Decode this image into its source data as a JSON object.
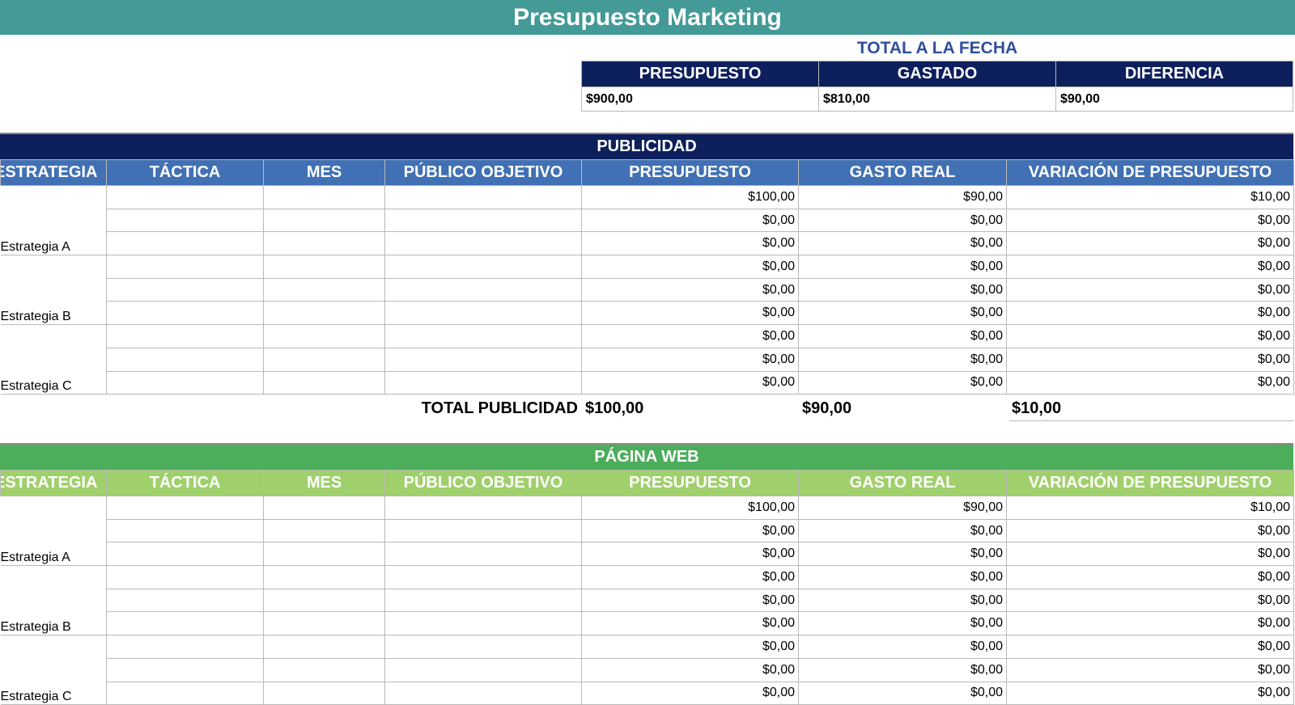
{
  "title": "Presupuesto Marketing",
  "totals": {
    "caption": "TOTAL A LA FECHA",
    "headers": [
      "PRESUPUESTO",
      "GASTADO",
      "DIFERENCIA"
    ],
    "values": [
      "$900,00",
      "$810,00",
      "$90,00"
    ]
  },
  "columns": [
    "ESTRATEGIA",
    "TÁCTICA",
    "MES",
    "PÚBLICO OBJETIVO",
    "PRESUPUESTO",
    "GASTO REAL",
    "VARIACIÓN DE PRESUPUESTO"
  ],
  "sections": [
    {
      "name": "PUBLICIDAD",
      "rows": [
        {
          "strategy": "",
          "tactic": "",
          "month": "",
          "audience": "",
          "budget": "$100,00",
          "spent": "$90,00",
          "variance": "$10,00"
        },
        {
          "strategy": "",
          "tactic": "",
          "month": "",
          "audience": "",
          "budget": "$0,00",
          "spent": "$0,00",
          "variance": "$0,00"
        },
        {
          "strategy": "Estrategia A",
          "tactic": "",
          "month": "",
          "audience": "",
          "budget": "$0,00",
          "spent": "$0,00",
          "variance": "$0,00"
        },
        {
          "strategy": "",
          "tactic": "",
          "month": "",
          "audience": "",
          "budget": "$0,00",
          "spent": "$0,00",
          "variance": "$0,00"
        },
        {
          "strategy": "",
          "tactic": "",
          "month": "",
          "audience": "",
          "budget": "$0,00",
          "spent": "$0,00",
          "variance": "$0,00"
        },
        {
          "strategy": "Estrategia B",
          "tactic": "",
          "month": "",
          "audience": "",
          "budget": "$0,00",
          "spent": "$0,00",
          "variance": "$0,00"
        },
        {
          "strategy": "",
          "tactic": "",
          "month": "",
          "audience": "",
          "budget": "$0,00",
          "spent": "$0,00",
          "variance": "$0,00"
        },
        {
          "strategy": "",
          "tactic": "",
          "month": "",
          "audience": "",
          "budget": "$0,00",
          "spent": "$0,00",
          "variance": "$0,00"
        },
        {
          "strategy": "Estrategia C",
          "tactic": "",
          "month": "",
          "audience": "",
          "budget": "$0,00",
          "spent": "$0,00",
          "variance": "$0,00"
        }
      ],
      "total": {
        "label": "TOTAL PUBLICIDAD",
        "budget": "$100,00",
        "spent": "$90,00",
        "variance": "$10,00"
      }
    },
    {
      "name": "PÁGINA WEB",
      "rows": [
        {
          "strategy": "",
          "tactic": "",
          "month": "",
          "audience": "",
          "budget": "$100,00",
          "spent": "$90,00",
          "variance": "$10,00"
        },
        {
          "strategy": "",
          "tactic": "",
          "month": "",
          "audience": "",
          "budget": "$0,00",
          "spent": "$0,00",
          "variance": "$0,00"
        },
        {
          "strategy": "Estrategia A",
          "tactic": "",
          "month": "",
          "audience": "",
          "budget": "$0,00",
          "spent": "$0,00",
          "variance": "$0,00"
        },
        {
          "strategy": "",
          "tactic": "",
          "month": "",
          "audience": "",
          "budget": "$0,00",
          "spent": "$0,00",
          "variance": "$0,00"
        },
        {
          "strategy": "",
          "tactic": "",
          "month": "",
          "audience": "",
          "budget": "$0,00",
          "spent": "$0,00",
          "variance": "$0,00"
        },
        {
          "strategy": "Estrategia B",
          "tactic": "",
          "month": "",
          "audience": "",
          "budget": "$0,00",
          "spent": "$0,00",
          "variance": "$0,00"
        },
        {
          "strategy": "",
          "tactic": "",
          "month": "",
          "audience": "",
          "budget": "$0,00",
          "spent": "$0,00",
          "variance": "$0,00"
        },
        {
          "strategy": "",
          "tactic": "",
          "month": "",
          "audience": "",
          "budget": "$0,00",
          "spent": "$0,00",
          "variance": "$0,00"
        },
        {
          "strategy": "Estrategia C",
          "tactic": "",
          "month": "",
          "audience": "",
          "budget": "$0,00",
          "spent": "$0,00",
          "variance": "$0,00"
        }
      ]
    }
  ]
}
